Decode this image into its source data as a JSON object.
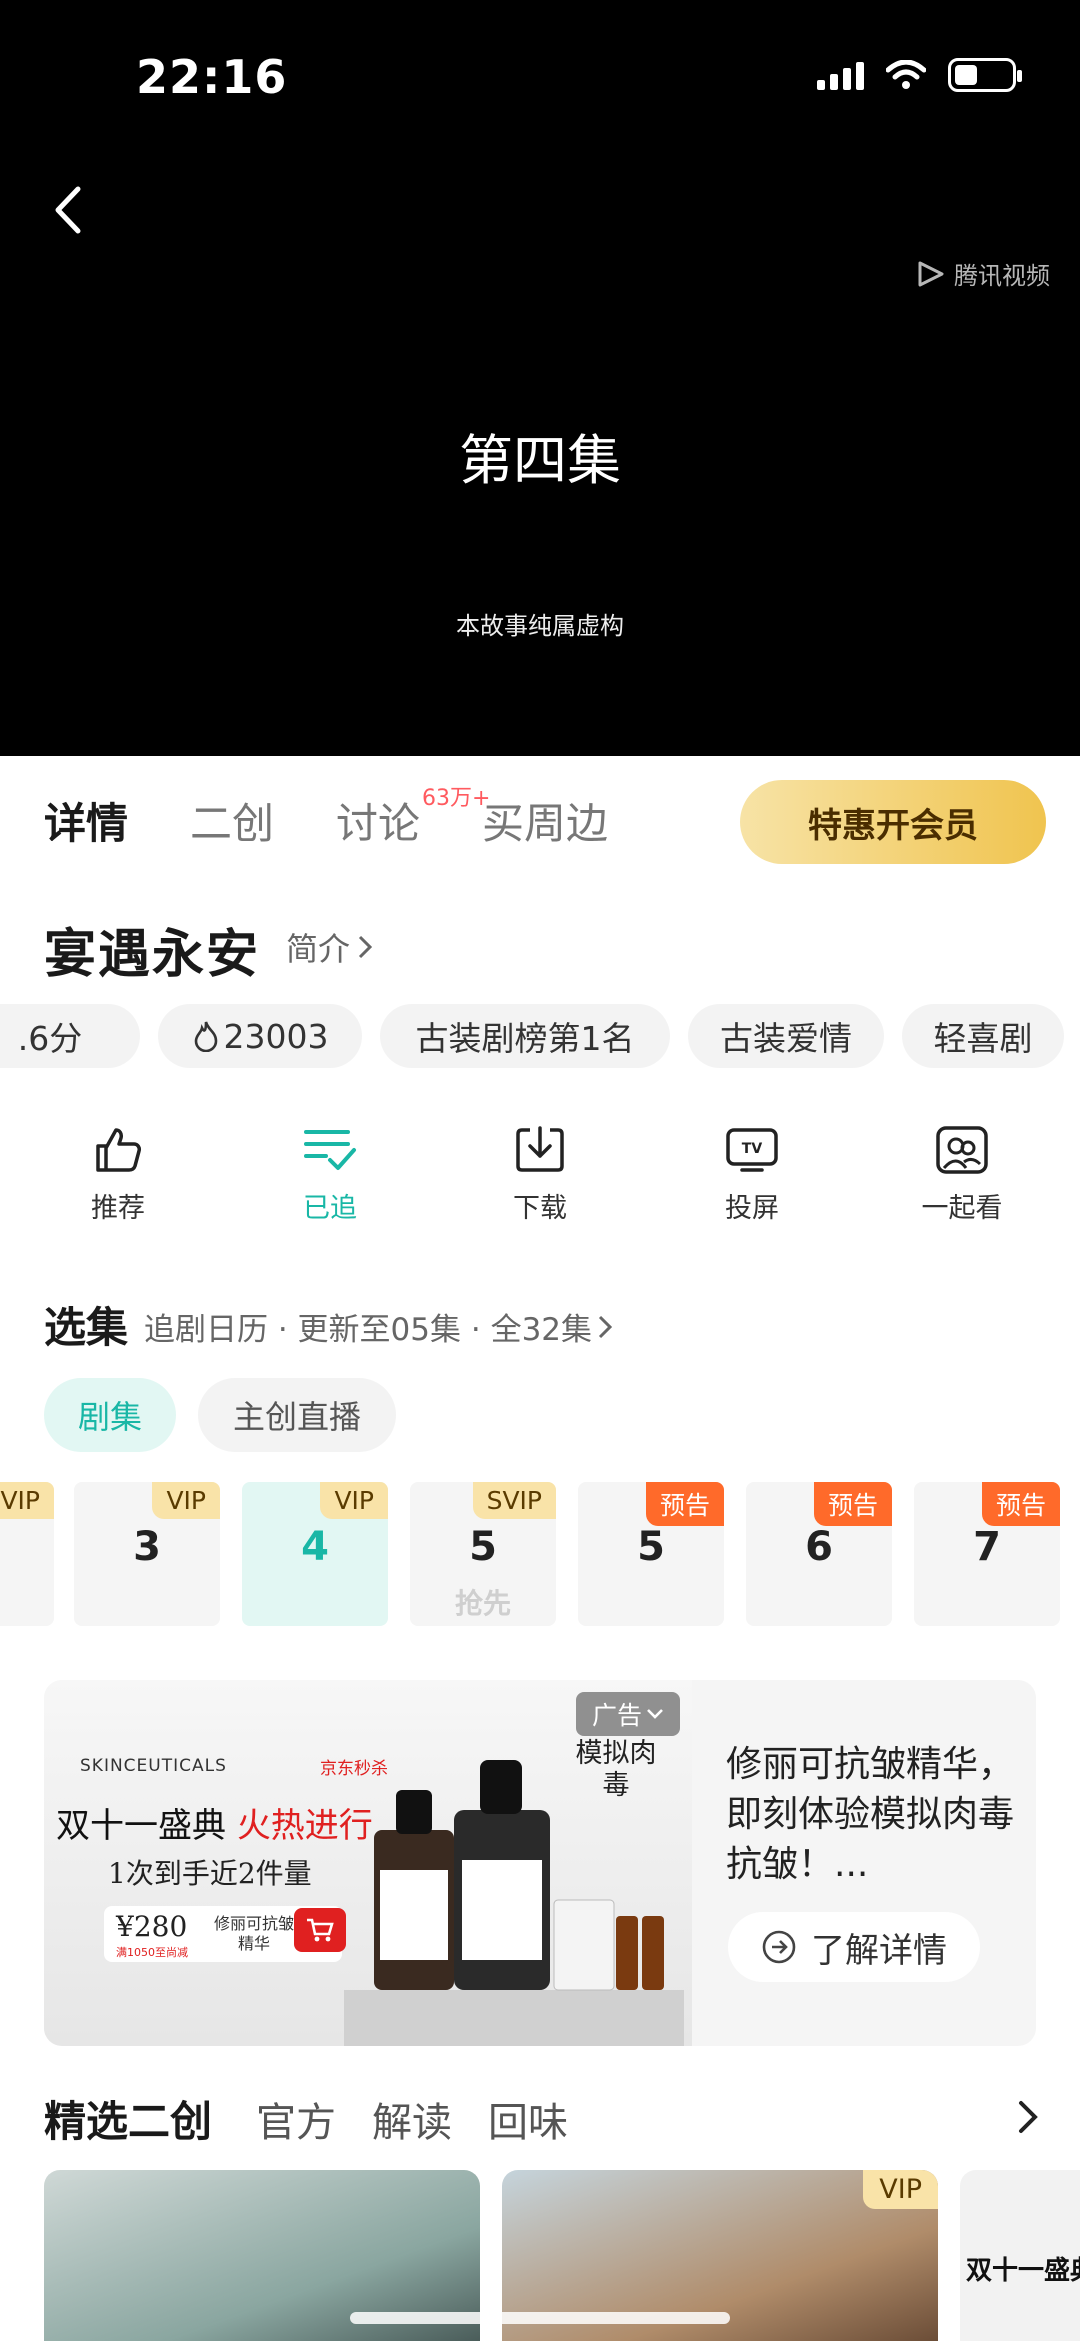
{
  "status_bar": {
    "time": "22:16"
  },
  "player": {
    "watermark": "腾讯视频",
    "episode_title": "第四集",
    "disclaimer": "本故事纯属虚构"
  },
  "tabs": [
    {
      "label": "详情",
      "active": true
    },
    {
      "label": "二创"
    },
    {
      "label": "讨论",
      "badge": "63万+"
    },
    {
      "label": "买周边"
    }
  ],
  "vip_button": "特惠开会员",
  "show": {
    "title": "宴遇永安",
    "intro_link": "简介"
  },
  "chips": [
    ".6分",
    "23003",
    "古装剧榜第1名",
    "古装爱情",
    "轻喜剧"
  ],
  "actions": [
    {
      "label": "推荐",
      "icon": "thumbs-up-icon"
    },
    {
      "label": "已追",
      "icon": "followed-icon",
      "active": true
    },
    {
      "label": "下载",
      "icon": "download-icon"
    },
    {
      "label": "投屏",
      "icon": "tv-cast-icon"
    },
    {
      "label": "一起看",
      "icon": "watch-together-icon"
    }
  ],
  "episode_selector": {
    "title": "选集",
    "info": "追剧日历 · 更新至05集 · 全32集",
    "filters": [
      "剧集",
      "主创直播"
    ],
    "episodes": [
      {
        "number": "",
        "tag": "VIP"
      },
      {
        "number": "3",
        "tag": "VIP"
      },
      {
        "number": "4",
        "tag": "VIP",
        "current": true
      },
      {
        "number": "5",
        "tag": "SVIP",
        "sub": "抢先"
      },
      {
        "number": "5",
        "tag": "预告"
      },
      {
        "number": "6",
        "tag": "预告"
      },
      {
        "number": "7",
        "tag": "预告"
      }
    ]
  },
  "ad": {
    "brand": "SKINCEUTICALS",
    "jd_label": "京东秒杀",
    "headline_black": "双十一盛典",
    "headline_red": "火热进行",
    "subline": "1次到手近2件量",
    "price": "¥280",
    "price_note": "满1050至尚减",
    "product": "修丽可抗皱精华",
    "tag": "广告",
    "side_text": "模拟肉毒",
    "description": "修丽可抗皱精华，即刻体验模拟肉毒抗皱！...",
    "cta": "了解详情"
  },
  "featured": {
    "title": "精选二创",
    "tabs": [
      "官方",
      "解读",
      "回味"
    ],
    "thumb_vip": "VIP",
    "thumb3_text": "双十一盛典"
  }
}
